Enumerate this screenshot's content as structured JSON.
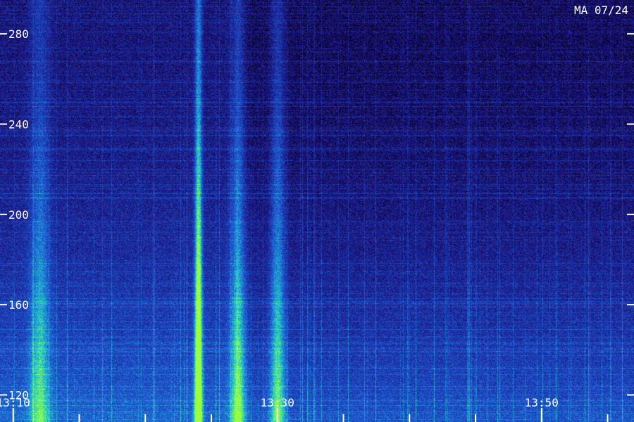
{
  "stamp": "MA 07/24",
  "colors": {
    "background": "#000000",
    "low": "#1a0a6e",
    "mid": "#1e5ad8",
    "high": "#22d2c8",
    "peak": "#9cff3c",
    "labels": "#ffffff"
  },
  "chart_data": {
    "type": "heatmap",
    "title": "",
    "xlabel": "",
    "ylabel": "",
    "x_ticks": [
      "13:10",
      "13:30",
      "13:50"
    ],
    "y_ticks": [
      120,
      160,
      200,
      240,
      280
    ],
    "ylim": [
      108,
      295
    ],
    "xlim": [
      "13:09",
      "13:57"
    ],
    "minor_x_ticks": [
      "13:05",
      "13:15",
      "13:20",
      "13:25",
      "13:35",
      "13:40",
      "13:45",
      "13:55"
    ],
    "features": [
      {
        "center": "13:24",
        "strength": 1.0,
        "label": "strong burst"
      },
      {
        "center": "13:27",
        "strength": 0.55,
        "label": "secondary burst"
      },
      {
        "center": "13:30",
        "strength": 0.5,
        "label": "secondary burst"
      },
      {
        "center": "13:12",
        "strength": 0.4,
        "label": "weak burst"
      }
    ]
  }
}
